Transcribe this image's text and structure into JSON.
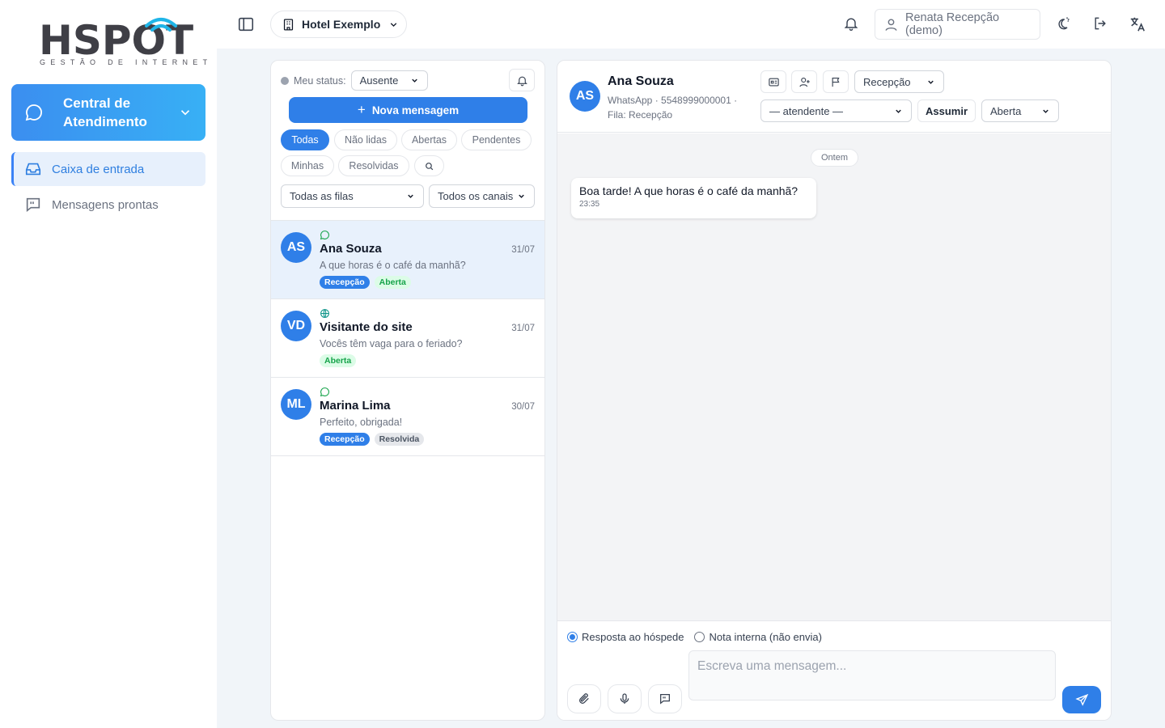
{
  "brand": {
    "logo_text": "HSPOT",
    "logo_sub": "GESTÃO DE INTERNET"
  },
  "sidebar": {
    "central_label": "Central de Atendimento",
    "items": [
      {
        "label": "Caixa de entrada",
        "icon": "inbox-icon",
        "active": true
      },
      {
        "label": "Mensagens prontas",
        "icon": "message-quote-icon",
        "active": false
      }
    ]
  },
  "topbar": {
    "hotel": "Hotel Exemplo",
    "user": "Renata Recepção (demo)"
  },
  "inbox": {
    "status_label": "Meu status:",
    "status_value": "Ausente",
    "new_message": "Nova mensagem",
    "filters": [
      "Todas",
      "Não lidas",
      "Abertas",
      "Pendentes",
      "Minhas",
      "Resolvidas"
    ],
    "active_filter": "Todas",
    "queue_select": "Todas as filas",
    "channel_select": "Todos os canais",
    "conversations": [
      {
        "initials": "AS",
        "name": "Ana Souza",
        "date": "31/07",
        "preview": "A que horas é o café da manhã?",
        "channel": "whatsapp-icon",
        "tags": [
          {
            "label": "Recepção",
            "kind": "blue"
          },
          {
            "label": "Aberta",
            "kind": "green"
          }
        ]
      },
      {
        "initials": "VD",
        "name": "Visitante do site",
        "date": "31/07",
        "preview": "Vocês têm vaga para o feriado?",
        "channel": "globe-icon",
        "tags": [
          {
            "label": "Aberta",
            "kind": "green"
          }
        ]
      },
      {
        "initials": "ML",
        "name": "Marina Lima",
        "date": "30/07",
        "preview": "Perfeito, obrigada!",
        "channel": "whatsapp-icon",
        "tags": [
          {
            "label": "Recepção",
            "kind": "blue"
          },
          {
            "label": "Resolvida",
            "kind": "gray"
          }
        ]
      }
    ]
  },
  "chat": {
    "initials": "AS",
    "name": "Ana Souza",
    "sub_line1": "WhatsApp · 5548999000001 ·",
    "sub_line2": "Fila: Recepção",
    "queue_select": "Recepção",
    "agent_select": "— atendente —",
    "assume": "Assumir",
    "state_select": "Aberta",
    "date_chip": "Ontem",
    "messages": [
      {
        "text": "Boa tarde! A que horas é o café da manhã?",
        "time": "23:35"
      }
    ],
    "reply_label": "Resposta ao hóspede",
    "note_label": "Nota interna (não envia)",
    "placeholder": "Escreva uma mensagem..."
  },
  "colors": {
    "accent": "#2f7fe8",
    "sidebar_active_bg": "#e7f0fc",
    "success": "#16a34a"
  }
}
